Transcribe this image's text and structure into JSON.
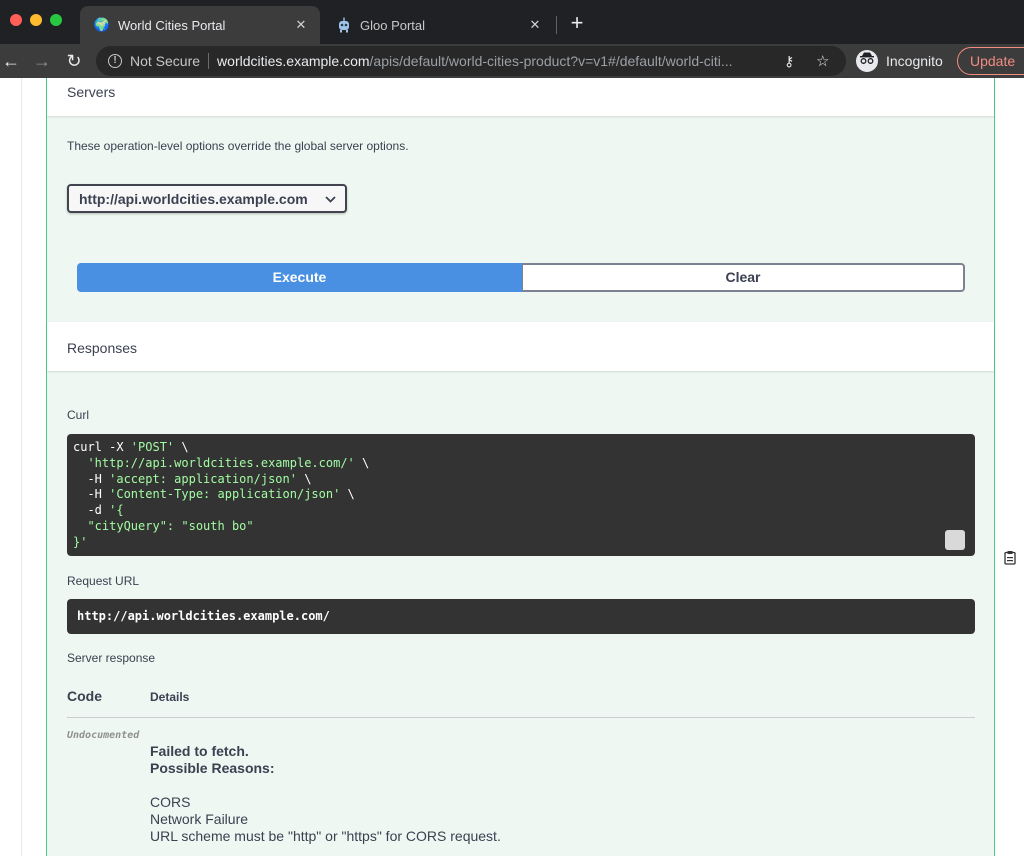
{
  "browser": {
    "tabs": [
      {
        "title": "World Cities Portal",
        "active": true,
        "favicon": "globe-icon"
      },
      {
        "title": "Gloo Portal",
        "active": false,
        "favicon": "gloo-bot-icon"
      }
    ],
    "close_glyph": "✕",
    "new_tab_glyph": "+",
    "security_label": "Not Secure",
    "url_host": "worldcities.example.com",
    "url_path": "/apis/default/world-cities-product?v=v1#/default/world-citi...",
    "incognito_label": "Incognito",
    "update_label": "Update"
  },
  "servers": {
    "title": "Servers",
    "note": "These operation-level options override the global server options.",
    "selected": "http://api.worldcities.example.com"
  },
  "actions": {
    "execute": "Execute",
    "clear": "Clear"
  },
  "responses": {
    "title": "Responses",
    "curl_label": "Curl",
    "curl_lines": {
      "l1a": "curl -X ",
      "l1b": "'POST'",
      "l1c": " \\",
      "l2a": "  ",
      "l2b": "'http://api.worldcities.example.com/'",
      "l2c": " \\",
      "l3a": "  -H ",
      "l3b": "'accept: application/json'",
      "l3c": " \\",
      "l4a": "  -H ",
      "l4b": "'Content-Type: application/json'",
      "l4c": " \\",
      "l5a": "  -d ",
      "l5b": "'{",
      "l6": "  \"cityQuery\": \"south bo\"",
      "l7": "}'"
    },
    "request_url_label": "Request URL",
    "request_url": "http://api.worldcities.example.com/",
    "server_response_label": "Server response",
    "col_code": "Code",
    "col_details": "Details",
    "code_value": "Undocumented",
    "error_title": "Failed to fetch.",
    "reasons_title": "Possible Reasons:",
    "reasons": [
      "CORS",
      "Network Failure",
      "URL scheme must be \"http\" or \"https\" for CORS request."
    ]
  }
}
